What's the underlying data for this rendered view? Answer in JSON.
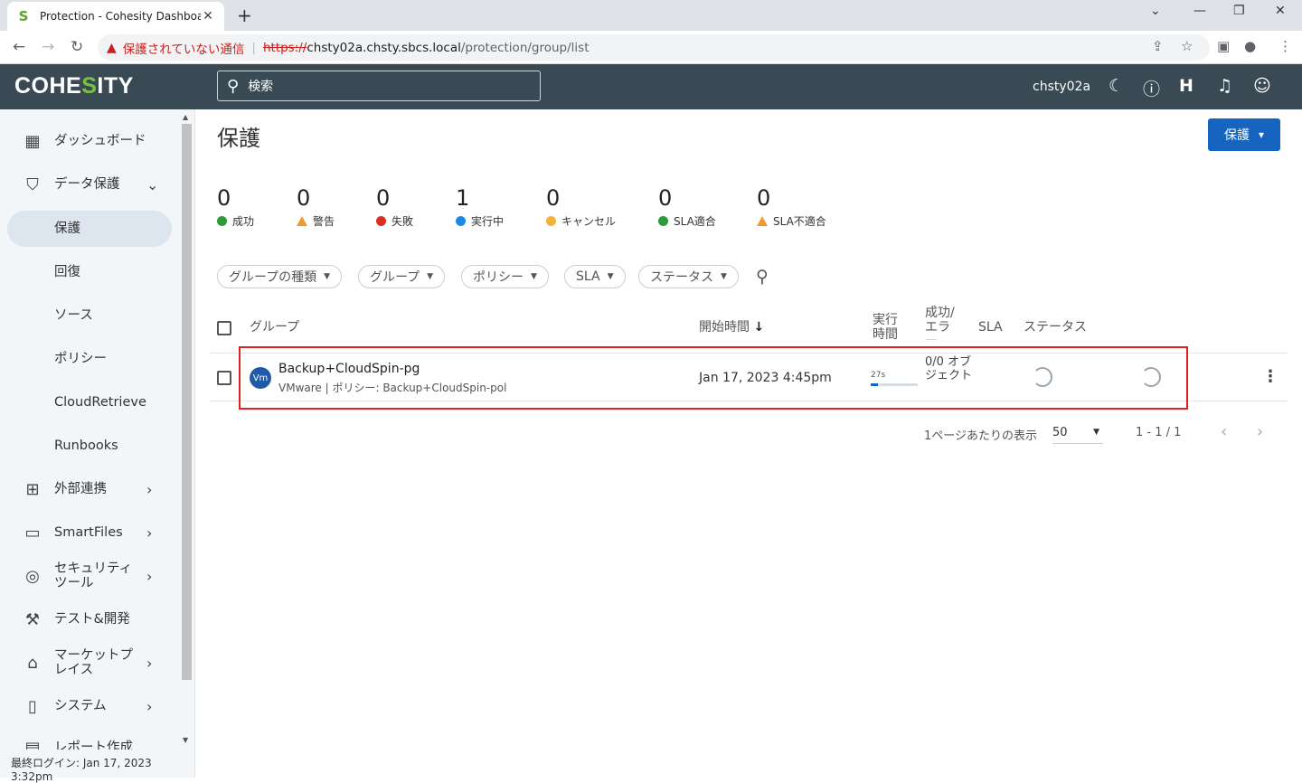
{
  "browser": {
    "tab_title": "Protection - Cohesity Dashboard",
    "not_secure": "保護されていない通信",
    "url_scheme": "https://",
    "url_host": "chsty02a.chsty.sbcs.local",
    "url_path": "/protection/group/list"
  },
  "header": {
    "logo_prefix": "COHE",
    "logo_s": "S",
    "logo_suffix": "ITY",
    "search_placeholder": "検索",
    "username": "chsty02a"
  },
  "sidebar": {
    "items": [
      {
        "label": "ダッシュボード"
      },
      {
        "label": "データ保護"
      },
      {
        "label": "保護"
      },
      {
        "label": "回復"
      },
      {
        "label": "ソース"
      },
      {
        "label": "ポリシー"
      },
      {
        "label": "CloudRetrieve"
      },
      {
        "label": "Runbooks"
      },
      {
        "label": "外部連携"
      },
      {
        "label": "SmartFiles"
      },
      {
        "label": "セキュリティツール"
      },
      {
        "label": "テスト&開発"
      },
      {
        "label": "マーケットプレイス"
      },
      {
        "label": "システム"
      },
      {
        "label": "レポート作成"
      }
    ],
    "last_login": "最終ログイン: Jan 17, 2023 3:32pm"
  },
  "page": {
    "title": "保護",
    "protect_button": "保護"
  },
  "stats": [
    {
      "value": "0",
      "label": "成功",
      "color": "#2e9b3a"
    },
    {
      "value": "0",
      "label": "警告",
      "color": "#f2992e"
    },
    {
      "value": "0",
      "label": "失敗",
      "color": "#d93025"
    },
    {
      "value": "1",
      "label": "実行中",
      "color": "#1e88e5"
    },
    {
      "value": "0",
      "label": "キャンセル",
      "color": "#f2b33d"
    },
    {
      "value": "0",
      "label": "SLA適合",
      "color": "#2e9b3a"
    },
    {
      "value": "0",
      "label": "SLA不適合",
      "color": "#f2992e"
    }
  ],
  "filters": [
    "グループの種類",
    "グループ",
    "ポリシー",
    "SLA",
    "ステータス"
  ],
  "table": {
    "headers": {
      "group": "グループ",
      "start_time": "開始時間",
      "duration": "実行時間",
      "success_error": "成功/エラー",
      "sla": "SLA",
      "status": "ステータス"
    },
    "rows": [
      {
        "avatar": "Vm",
        "name": "Backup+CloudSpin-pg",
        "subtitle": "VMware | ポリシー: Backup+CloudSpin-pol",
        "start": "Jan 17, 2023 4:45pm",
        "duration": "27s",
        "progress": 0.15,
        "objects": "0/0 オブジェクト"
      }
    ]
  },
  "pagination": {
    "per_page_label": "1ページあたりの表示",
    "per_page_value": "50",
    "range": "1 - 1 / 1"
  }
}
